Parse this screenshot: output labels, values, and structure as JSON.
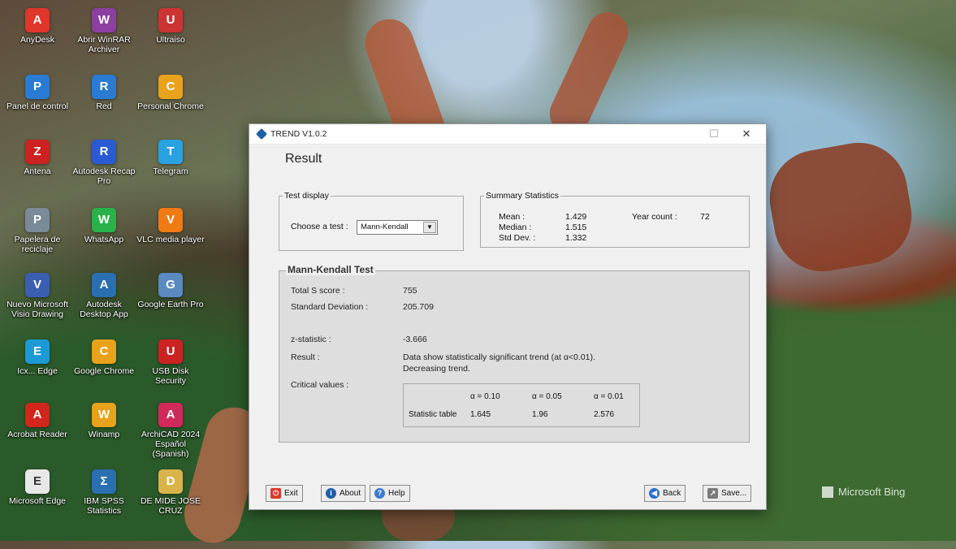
{
  "desktop": {
    "icons": [
      {
        "label": "AnyDesk",
        "glyph": "A",
        "color": "#e0362b"
      },
      {
        "label": "Abrir WinRAR Archiver",
        "glyph": "W",
        "color": "#8b3fa0"
      },
      {
        "label": "Ultraiso",
        "glyph": "U",
        "color": "#c33"
      },
      {
        "label": "Panel de control",
        "glyph": "P",
        "color": "#2a7bd4"
      },
      {
        "label": "Red",
        "glyph": "R",
        "color": "#2a7bd4"
      },
      {
        "label": "Personal Chrome",
        "glyph": "C",
        "color": "#e8a21b"
      },
      {
        "label": "Antena",
        "glyph": "Z",
        "color": "#c22"
      },
      {
        "label": "Autodesk Recap Pro",
        "glyph": "R",
        "color": "#2a5bd4"
      },
      {
        "label": "Telegram",
        "glyph": "T",
        "color": "#2aa1e0"
      },
      {
        "label": "Papelera de reciclaje",
        "glyph": "P",
        "color": "#7a8a99"
      },
      {
        "label": "WhatsApp",
        "glyph": "W",
        "color": "#27b34a"
      },
      {
        "label": "VLC media player",
        "glyph": "V",
        "color": "#f07a14"
      },
      {
        "label": "Nuevo Microsoft Visio Drawing",
        "glyph": "V",
        "color": "#3b5fb0"
      },
      {
        "label": "Autodesk Desktop App",
        "glyph": "A",
        "color": "#2a6fb0"
      },
      {
        "label": "Google Earth Pro",
        "glyph": "G",
        "color": "#5a8ac0"
      },
      {
        "label": "Icx... Edge",
        "glyph": "E",
        "color": "#1b9ad6"
      },
      {
        "label": "Google Chrome",
        "glyph": "C",
        "color": "#e8a21b"
      },
      {
        "label": "USB Disk Security",
        "glyph": "U",
        "color": "#c22"
      },
      {
        "label": "Acrobat Reader",
        "glyph": "A",
        "color": "#d1261b"
      },
      {
        "label": "Winamp",
        "glyph": "W",
        "color": "#e8a21b"
      },
      {
        "label": "ArchiCAD 2024 Español (Spanish)",
        "glyph": "A",
        "color": "#d12a5a"
      },
      {
        "label": "Microsoft Edge",
        "glyph": "E",
        "color": "#e8e8e8"
      },
      {
        "label": "IBM SPSS Statistics",
        "glyph": "Σ",
        "color": "#2a6fb0"
      },
      {
        "label": "DE MIDE JOSE CRUZ",
        "glyph": "D",
        "color": "#d9b44a"
      }
    ],
    "bing_watermark": "Microsoft Bing"
  },
  "window": {
    "title": "TREND V1.0.2",
    "minimize_glyph": "☐",
    "close_glyph": "✕",
    "page_title": "Result",
    "test_display": {
      "legend": "Test display",
      "choose_label": "Choose a test :",
      "selected_test": "Mann-Kendall"
    },
    "summary": {
      "legend": "Summary Statistics",
      "mean_label": "Mean :",
      "mean_value": "1.429",
      "median_label": "Median :",
      "median_value": "1.515",
      "std_label": "Std Dev. :",
      "std_value": "1.332",
      "year_count_label": "Year count :",
      "year_count_value": "72"
    },
    "mann_kendall": {
      "title": "Mann-Kendall Test",
      "total_score_label": "Total S score :",
      "total_score_value": "755",
      "std_dev_label": "Standard Deviation :",
      "std_dev_value": "205.709",
      "z_label": "z-statistic :",
      "z_value": "-3.666",
      "result_label": "Result :",
      "result_line1": "Data show statistically significant trend (at α<0.01).",
      "result_line2": "Decreasing trend.",
      "critical_label": "Critical values :",
      "critical": {
        "headers": [
          "α = 0.10",
          "α = 0.05",
          "α = 0.01"
        ],
        "row_label": "Statistic table",
        "values": [
          "1.645",
          "1.96",
          "2.576"
        ]
      }
    },
    "buttons": {
      "exit": "Exit",
      "about": "About",
      "help": "Help",
      "back": "Back",
      "save": "Save..."
    }
  }
}
